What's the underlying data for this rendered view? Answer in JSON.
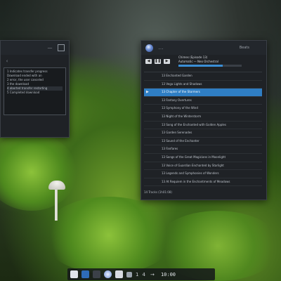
{
  "left_window": {
    "lines": [
      "1 Indicates transfer progress",
      "Download ended with an",
      "2 error, the user canceled",
      "3 the download",
      "4 aborted transfer restarting",
      "5 Completed download"
    ]
  },
  "player": {
    "title": "Beats",
    "now_playing": "Chimes (Episode 13)",
    "now_playing_sub": "Automatic — Neo Orchestral",
    "progress_fraction": 0.7,
    "tracks": [
      {
        "mark": "",
        "label": "13 Enchanted Garden"
      },
      {
        "mark": "",
        "label": "13 Vega Lights and Shadows"
      },
      {
        "mark": "▶",
        "label": "13 Chapter of the Stormers",
        "active": true
      },
      {
        "mark": "",
        "label": "13 Fantasy Overtures"
      },
      {
        "mark": "",
        "label": "13 Symphony of the Wind"
      },
      {
        "mark": "",
        "label": "13 Night of the Winterstorm"
      },
      {
        "mark": "",
        "label": "13 Song of the Enchanted with Golden Apples"
      },
      {
        "mark": "",
        "label": "13 Garden Serenades"
      },
      {
        "mark": "",
        "label": "13 Sound of the Enchanter"
      },
      {
        "mark": "",
        "label": "13 Fanfares"
      },
      {
        "mark": "",
        "label": "13 Songs of the Great Magicians in Moonlight"
      },
      {
        "mark": "",
        "label": "13 Voice of Guardian Enchanted by Starlight"
      },
      {
        "mark": "",
        "label": "13 Legends and Symphonies of Wonders"
      },
      {
        "mark": "",
        "label": "13 At Requiem in the Enchantments of Meadows"
      }
    ],
    "status": "14 Tracks (1h01:08)"
  },
  "taskbar": {
    "pager_1": "1",
    "pager_2": "4",
    "clock": "10:00"
  },
  "colors": {
    "accent": "#2f7ec4",
    "window_bg": "#1f2226"
  }
}
